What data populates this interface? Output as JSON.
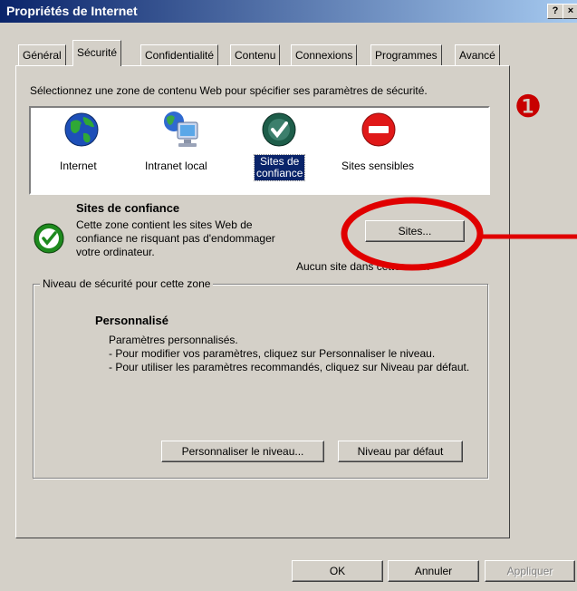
{
  "window": {
    "title": "Propriétés de Internet",
    "help_button": "?",
    "close_button": "×"
  },
  "tabs": [
    {
      "label": "Général",
      "active": false
    },
    {
      "label": "Sécurité",
      "active": true
    },
    {
      "label": "Confidentialité",
      "active": false
    },
    {
      "label": "Contenu",
      "active": false
    },
    {
      "label": "Connexions",
      "active": false
    },
    {
      "label": "Programmes",
      "active": false
    },
    {
      "label": "Avancé",
      "active": false
    }
  ],
  "security": {
    "instruction": "Sélectionnez une zone de contenu Web pour spécifier ses paramètres de sécurité.",
    "zones": [
      {
        "label": "Internet",
        "icon": "globe-icon"
      },
      {
        "label": "Intranet local",
        "icon": "network-computer-icon"
      },
      {
        "label_line1": "Sites de",
        "label_line2": "confiance",
        "icon": "checkmark-icon",
        "selected": true
      },
      {
        "label": "Sites sensibles",
        "icon": "restricted-icon"
      }
    ],
    "selected_zone": {
      "title": "Sites de confiance",
      "description": "Cette zone contient les sites Web de confiance ne risquant pas d'endommager votre ordinateur.",
      "sites_button": "Sites...",
      "sites_status": "Aucun site dans cette zone."
    },
    "level_group": {
      "legend": "Niveau de sécurité pour cette zone",
      "level_name": "Personnalisé",
      "lines": [
        "Paramètres personnalisés.",
        "- Pour modifier vos paramètres, cliquez sur Personnaliser le niveau.",
        "- Pour utiliser les paramètres recommandés, cliquez sur Niveau par défaut."
      ],
      "custom_button": "Personnaliser le niveau...",
      "default_button": "Niveau par défaut"
    }
  },
  "footer": {
    "ok": "OK",
    "cancel": "Annuler",
    "apply": "Appliquer"
  },
  "annotation": {
    "marker": "❶",
    "color": "#e00000"
  }
}
